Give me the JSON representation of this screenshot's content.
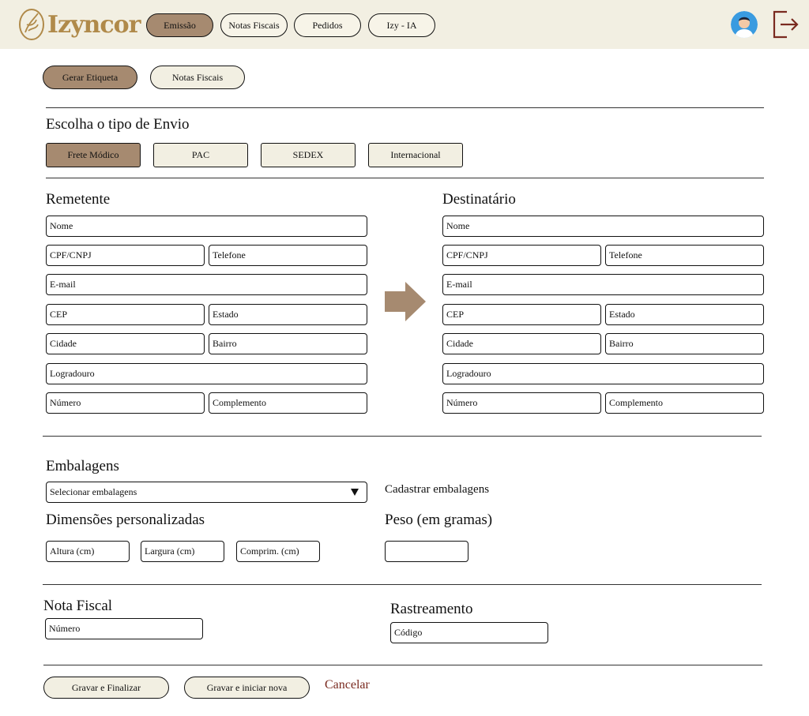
{
  "header": {
    "logo_text": "Izyncor",
    "nav": [
      {
        "label": "Emissão",
        "active": true
      },
      {
        "label": "Notas Fiscais",
        "active": false
      },
      {
        "label": "Pedidos",
        "active": false
      },
      {
        "label": "Izy - IA",
        "active": false
      }
    ],
    "icons": {
      "avatar": "user-avatar-icon",
      "logout": "logout-icon"
    }
  },
  "subnav": {
    "gerar_etiqueta": "Gerar Etiqueta",
    "notas_fiscais": "Notas Fiscais"
  },
  "envio": {
    "title": "Escolha o tipo de Envio",
    "options": [
      "Frete Módico",
      "PAC",
      "SEDEX",
      "Internacional"
    ],
    "selected": "Frete Módico"
  },
  "remetente": {
    "title": "Remetente",
    "fields": {
      "nome": "Nome",
      "cpf": "CPF/CNPJ",
      "telefone": "Telefone",
      "email": "E-mail",
      "cep": "CEP",
      "estado": "Estado",
      "cidade": "Cidade",
      "bairro": "Bairro",
      "logradouro": "Logradouro",
      "numero": "Número",
      "complemento": "Complemento"
    }
  },
  "destinatario": {
    "title": "Destinatário",
    "fields": {
      "nome": "Nome",
      "cpf": "CPF/CNPJ",
      "telefone": "Telefone",
      "email": "E-mail",
      "cep": "CEP",
      "estado": "Estado",
      "cidade": "Cidade",
      "bairro": "Bairro",
      "logradouro": "Logradouro",
      "numero": "Número",
      "complemento": "Complemento"
    }
  },
  "embalagens": {
    "title": "Embalagens",
    "select_value": "Selecionar embalagens",
    "cadastrar": "Cadastrar embalagens"
  },
  "dimensoes": {
    "title": "Dimensões personalizadas",
    "altura": "Altura (cm)",
    "largura": "Largura (cm)",
    "comprimento": "Comprim. (cm)"
  },
  "peso": {
    "title": "Peso (em gramas)",
    "value": ""
  },
  "nota_fiscal": {
    "title": "Nota Fiscal",
    "numero": "Número"
  },
  "rastreamento": {
    "title": "Rastreamento",
    "codigo": "Código"
  },
  "actions": {
    "gravar_finalizar": "Gravar e Finalizar",
    "gravar_nova": "Gravar e iniciar nova",
    "cancelar": "Cancelar"
  },
  "colors": {
    "header_bg": "#f2efe2",
    "accent_brown": "#a68a70",
    "logo_gold": "#b08a4a",
    "cancel_red": "#7a2a1f"
  }
}
